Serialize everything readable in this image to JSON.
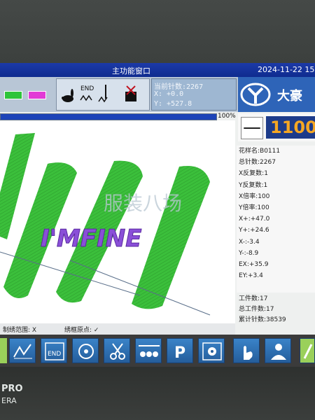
{
  "window": {
    "title": "主功能窗口",
    "datetime": "2024-11-22 15"
  },
  "counter": {
    "stitch_count_label": "当前针数:2267",
    "x_value": "X: +0.0",
    "y_value": "Y: +527.8"
  },
  "progress": {
    "percent": 100,
    "label": "100%"
  },
  "brand": {
    "name": "大豪",
    "accent": "#2e64b8"
  },
  "speed": {
    "minus_label": "—",
    "value": "1100"
  },
  "canvas": {
    "embroidery_text": "I'MFINE",
    "watermark": "服装八场"
  },
  "footer": {
    "frame_range_label": "制绣范围:  X",
    "origin_label": "绣框原点:  ✓"
  },
  "info": {
    "pattern_name": "花样名:B0111",
    "total_stitches": "总针数:2267",
    "x_repeat": "X反复数:1",
    "y_repeat": "Y反复数:1",
    "x_scale": "X倍率:100",
    "y_scale": "Y倍率:100",
    "x_plus": "X+:+47.0",
    "y_plus": "Y+:+24.6",
    "x_minus": "X-:-3.4",
    "y_minus": "Y-:-8.9",
    "ex": "EX:+35.9",
    "ey": "EY:+3.4"
  },
  "stats": {
    "workpieces": "工件数:17",
    "total_workpieces": "总工件数:17",
    "cumulative_stitches": "累计针数:38539"
  },
  "toolbar": {
    "end_label": "END"
  },
  "bottom": {
    "end_label": "END",
    "p_label": "P"
  },
  "phone": {
    "brand": "PRO",
    "sub": "ERA"
  },
  "colors": {
    "title_bar": "#1c3aa8",
    "embroidery_green": "#3bbf3b",
    "text_purple": "#8a4fd8"
  }
}
